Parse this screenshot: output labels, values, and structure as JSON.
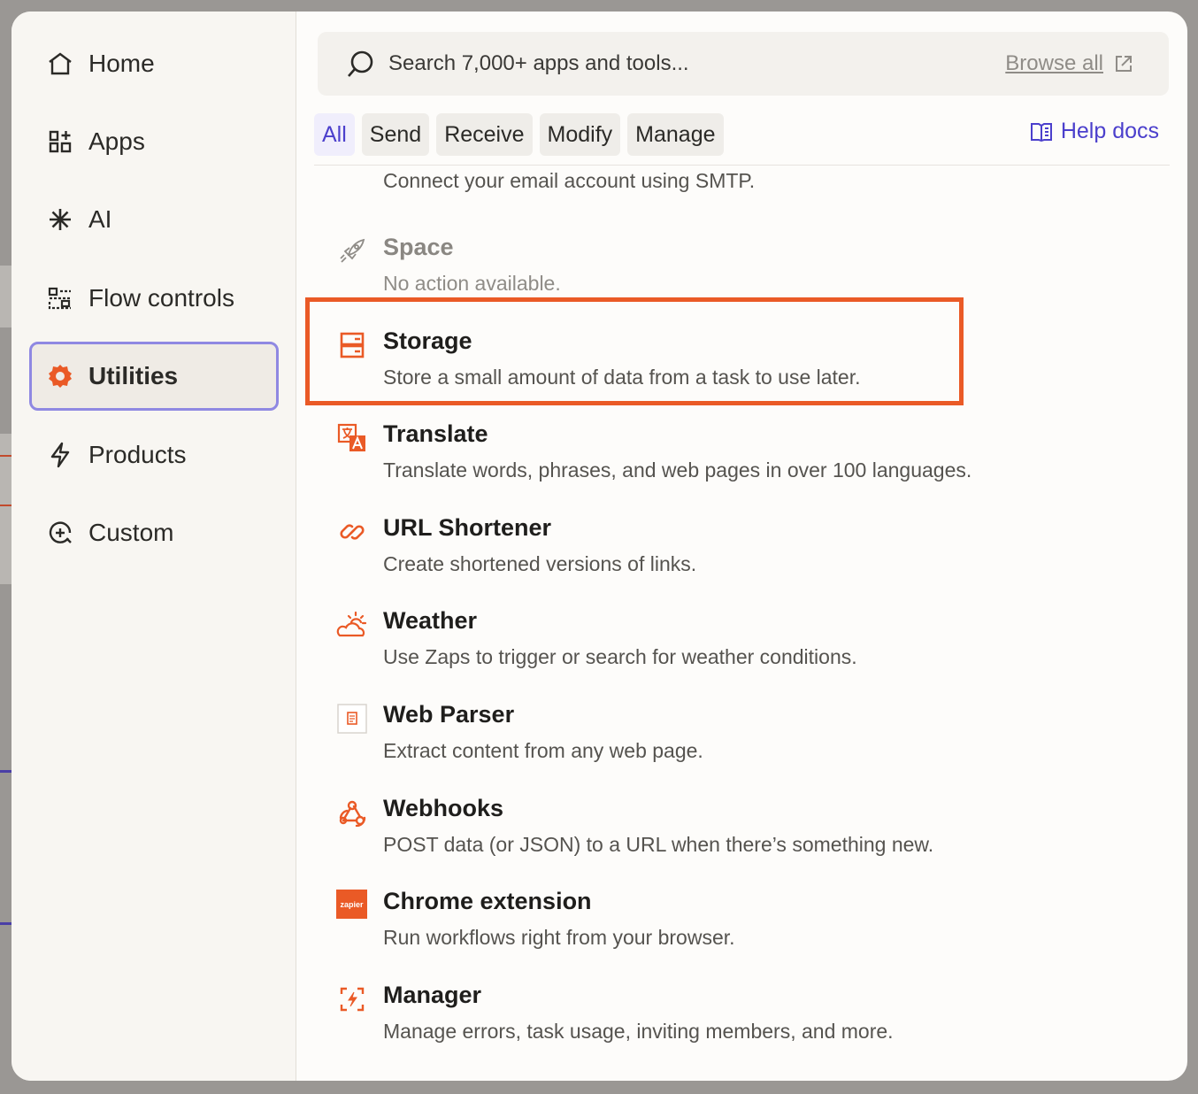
{
  "sidebar": {
    "items": [
      {
        "label": "Home",
        "icon": "home-icon"
      },
      {
        "label": "Apps",
        "icon": "apps-icon"
      },
      {
        "label": "AI",
        "icon": "ai-sparkle-icon"
      },
      {
        "label": "Flow controls",
        "icon": "flow-controls-icon"
      },
      {
        "label": "Utilities",
        "icon": "utilities-gear-icon",
        "active": true
      },
      {
        "label": "Products",
        "icon": "bolt-icon"
      },
      {
        "label": "Custom",
        "icon": "custom-plus-icon"
      }
    ]
  },
  "search": {
    "placeholder": "Search 7,000+ apps and tools...",
    "browse_label": "Browse all"
  },
  "tabs": [
    {
      "label": "All",
      "active": true
    },
    {
      "label": "Send"
    },
    {
      "label": "Receive"
    },
    {
      "label": "Modify"
    },
    {
      "label": "Manage"
    }
  ],
  "help_label": "Help docs",
  "list": {
    "truncated_desc": "Connect your email account using SMTP.",
    "items": [
      {
        "title": "Space",
        "desc": "No action available.",
        "icon": "rocket-icon",
        "disabled": true
      },
      {
        "title": "Storage",
        "desc": "Store a small amount of data from a task to use later.",
        "icon": "storage-icon",
        "highlighted": true
      },
      {
        "title": "Translate",
        "desc": "Translate words, phrases, and web pages in over 100 languages.",
        "icon": "translate-icon"
      },
      {
        "title": "URL Shortener",
        "desc": "Create shortened versions of links.",
        "icon": "link-icon"
      },
      {
        "title": "Weather",
        "desc": "Use Zaps to trigger or search for weather conditions.",
        "icon": "weather-icon"
      },
      {
        "title": "Web Parser",
        "desc": "Extract content from any web page.",
        "icon": "web-parser-icon"
      },
      {
        "title": "Webhooks",
        "desc": "POST data (or JSON) to a URL when there’s something new.",
        "icon": "webhooks-icon"
      },
      {
        "title": "Chrome extension",
        "desc": "Run workflows right from your browser.",
        "icon": "zapier-logo-icon",
        "logo_text": "zapier"
      },
      {
        "title": "Manager",
        "desc": "Manage errors, task usage, inviting members, and more.",
        "icon": "manager-icon"
      }
    ]
  },
  "colors": {
    "accent": "#4b3fcc",
    "brand_orange": "#ea5a26",
    "active_border": "#8f88e2"
  }
}
